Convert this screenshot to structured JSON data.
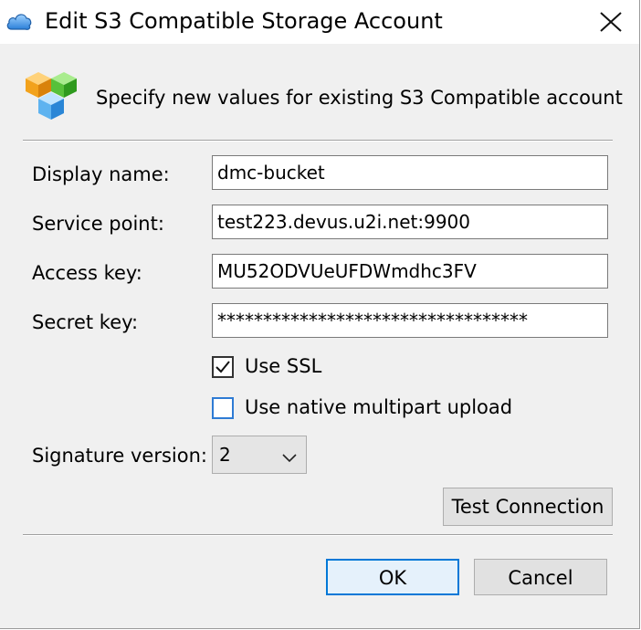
{
  "window": {
    "title": "Edit S3 Compatible Storage Account",
    "icon": "cloud-storage-icon",
    "close_icon": "close-icon"
  },
  "header": {
    "icon": "cubes-icon",
    "text": "Specify new values for existing S3 Compatible account"
  },
  "form": {
    "display_name_label": "Display name:",
    "display_name_value": "dmc-bucket",
    "service_point_label": "Service point:",
    "service_point_value": "test223.devus.u2i.net:9900",
    "access_key_label": "Access key:",
    "access_key_value": "MU52ODVUeUFDWmdhc3FV",
    "secret_key_label": "Secret key:",
    "secret_key_value": "**********************************",
    "use_ssl_label": "Use SSL",
    "use_ssl_checked": true,
    "multipart_label": "Use native multipart upload",
    "multipart_checked": false,
    "signature_label": "Signature version:",
    "signature_value": "2"
  },
  "buttons": {
    "test_connection": "Test Connection",
    "ok": "OK",
    "cancel": "Cancel"
  },
  "colors": {
    "accent": "#0078d7",
    "checkbox_focus": "#2e7bd4",
    "dialog_background": "#f0f0f0"
  }
}
